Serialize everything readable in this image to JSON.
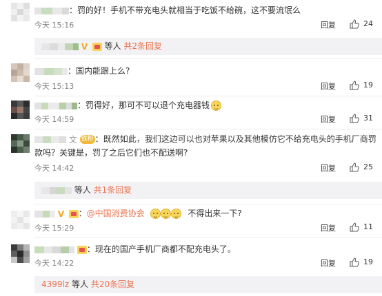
{
  "comments": [
    {
      "text": "罚的好！手机不带充电头就相当于吃饭不给碗，这不要流氓么",
      "time": "今天 15:16",
      "reply_label": "回复",
      "likes": "24",
      "sub_replies": {
        "suffix": "等人",
        "more": "共2条回复"
      }
    },
    {
      "text": "国内能跟上么?",
      "time": "今天 15:13",
      "reply_label": "回复",
      "likes": "19"
    },
    {
      "text": "罚得好，那可不可以退个充电器钱",
      "time": "今天 14:59",
      "reply_label": "回复",
      "likes": "31"
    },
    {
      "badge": "铁粉",
      "text_line1": "既然如此，我们这边可以也对苹果以及其他模仿它不给充电头的手机厂商罚",
      "text_line2": "款吗？关键是，罚了之后它们也不配送啊?",
      "time": "今天 14:42",
      "reply_label": "回复",
      "likes": "25",
      "sub_replies": {
        "suffix": "等人",
        "more": "共1条回复"
      }
    },
    {
      "mention": "@中国消费协会",
      "text": "不得出来一下?",
      "time": "今天 15:29",
      "reply_label": "回复",
      "likes": "11"
    },
    {
      "text": "现在的国产手机厂商都不配充电头了。",
      "time": "今天 14:22",
      "reply_label": "回复",
      "likes": "19",
      "sub_replies": {
        "name": "4399lz",
        "suffix": "等人",
        "more": "共20条回复"
      }
    }
  ],
  "colors": {
    "accent": "#eb7350",
    "meta": "#808080",
    "sub_bg": "#f2f2f5"
  }
}
